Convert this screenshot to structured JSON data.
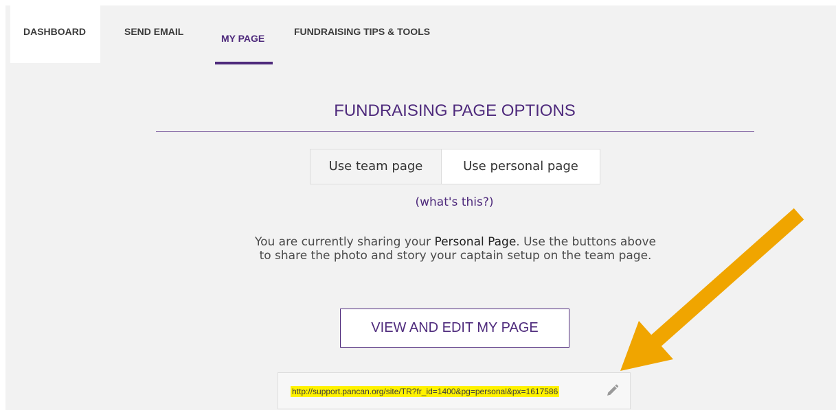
{
  "nav": {
    "tabs": [
      {
        "label": "DASHBOARD"
      },
      {
        "label": "SEND EMAIL"
      },
      {
        "label": "MY PAGE",
        "active": true
      },
      {
        "label": "FUNDRAISING TIPS & TOOLS"
      }
    ]
  },
  "options": {
    "title": "FUNDRAISING PAGE OPTIONS",
    "toggle": {
      "team_label": "Use team page",
      "personal_label": "Use personal page",
      "selected": "personal"
    },
    "help_open": "(",
    "help_link": "what's this?",
    "help_close": ")",
    "description": {
      "before": "You are currently sharing your ",
      "emphasis": "Personal Page",
      "after": ". Use the buttons above to share the photo and story your captain setup on the team page."
    },
    "view_edit_label": "VIEW AND EDIT MY PAGE",
    "page_url": "http://support.pancan.org/site/TR?fr_id=1400&pg=personal&px=1617586",
    "edit_icon": "pencil-icon"
  },
  "annotation": {
    "icon": "arrow-icon",
    "color": "#f0a500"
  },
  "colors": {
    "brand_purple": "#4e2a7c",
    "highlight": "#fff200",
    "panel_bg": "#f2f2f2"
  }
}
